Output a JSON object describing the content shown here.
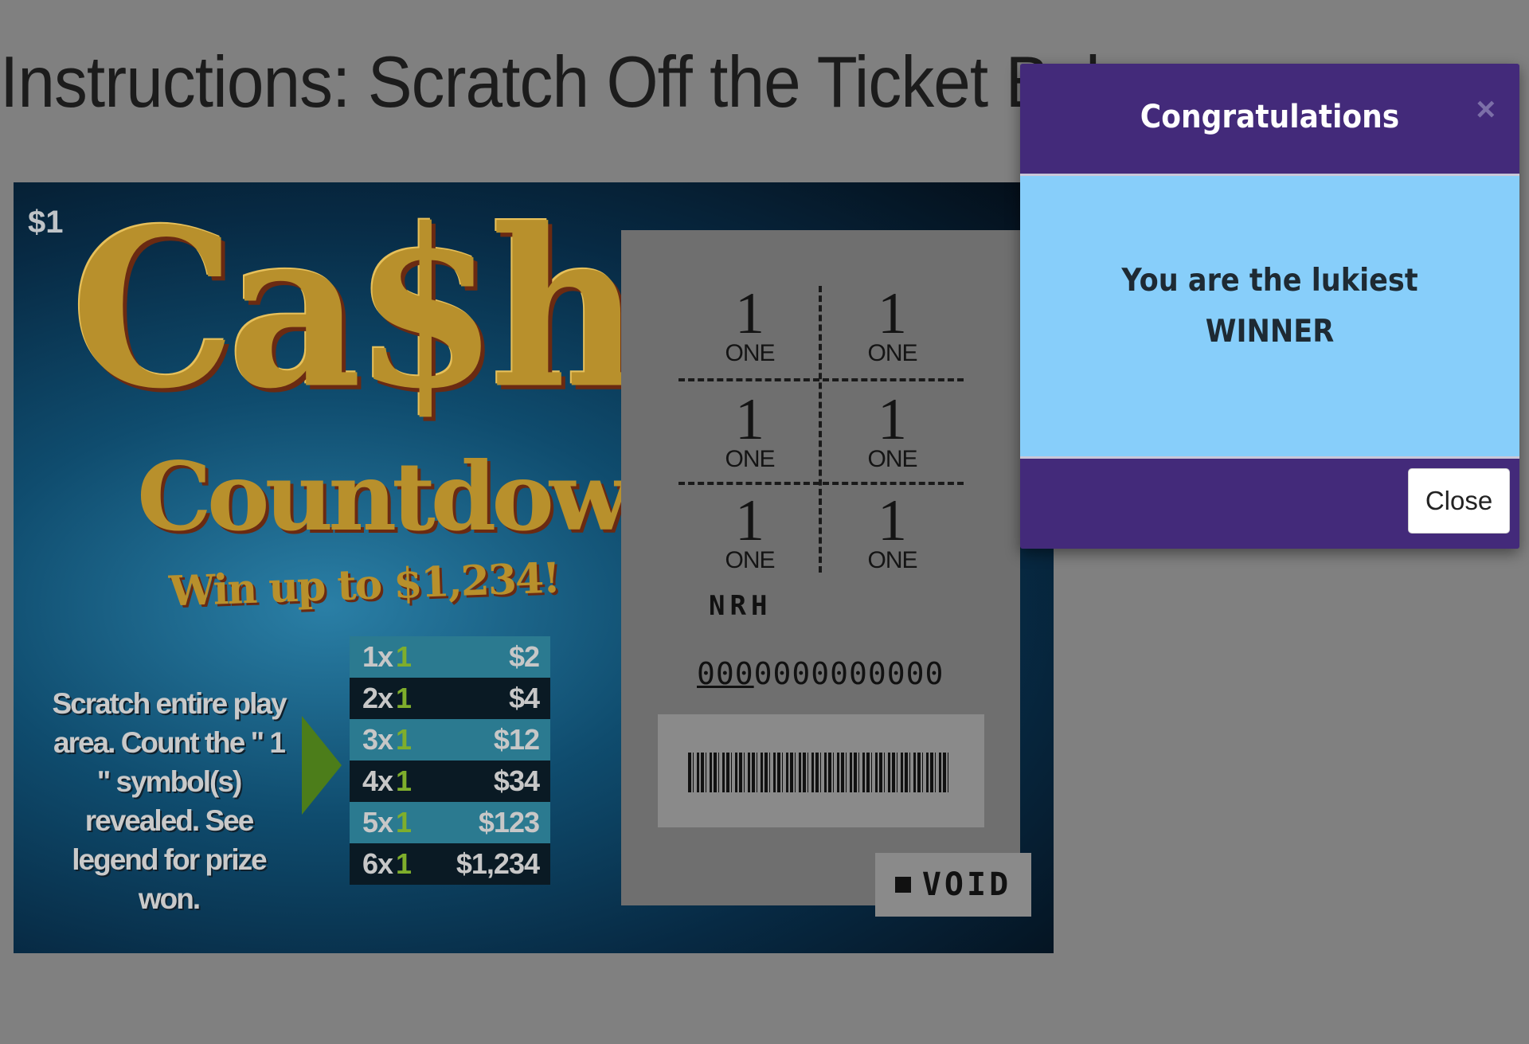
{
  "page": {
    "title": "Instructions: Scratch Off the Ticket Bel"
  },
  "ticket": {
    "price_tag": "$1",
    "logo_cash": "Ca$h",
    "logo_countdown": "Countdown",
    "logo_win": "Win up to $1,234!",
    "instructions": "Scratch entire play area. Count the \" 1 \" symbol(s) revealed. See legend for prize won.",
    "legend": [
      {
        "mult": "1x",
        "symbol": "1",
        "prize": "$2"
      },
      {
        "mult": "2x",
        "symbol": "1",
        "prize": "$4"
      },
      {
        "mult": "3x",
        "symbol": "1",
        "prize": "$12"
      },
      {
        "mult": "4x",
        "symbol": "1",
        "prize": "$34"
      },
      {
        "mult": "5x",
        "symbol": "1",
        "prize": "$123"
      },
      {
        "mult": "6x",
        "symbol": "1",
        "prize": "$1,234"
      }
    ],
    "symbols": [
      {
        "num": "1",
        "word": "ONE"
      },
      {
        "num": "1",
        "word": "ONE"
      },
      {
        "num": "1",
        "word": "ONE"
      },
      {
        "num": "1",
        "word": "ONE"
      },
      {
        "num": "1",
        "word": "ONE"
      },
      {
        "num": "1",
        "word": "ONE"
      }
    ],
    "code_letters": "NRH",
    "serial_underlined": "000",
    "serial_rest": "0000000000",
    "void_label": "VOID"
  },
  "modal": {
    "title": "Congratulations",
    "message_line1": "You are the lukiest",
    "message_line2": "WINNER",
    "close_x": "×",
    "close_label": "Close",
    "colors": {
      "header": "#432a7a",
      "body": "#87cefa"
    }
  }
}
